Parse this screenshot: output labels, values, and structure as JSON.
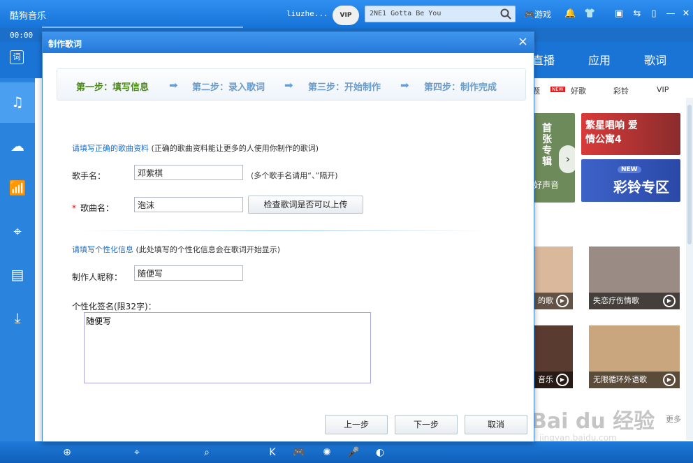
{
  "app": {
    "title": "酷狗音乐",
    "time": "00:00",
    "username": "liuzhe...",
    "vip": "VIP",
    "search_text": "2NE1 Gotta Be You",
    "game_label": "游戏",
    "lyric_icon": "词"
  },
  "nav": {
    "tabs": [
      "直播",
      "应用",
      "歌词"
    ]
  },
  "subnav": {
    "items": [
      "题",
      "好歌",
      "彩铃",
      "VIP"
    ],
    "new_tag": "NEW"
  },
  "banners": {
    "album_text": "首张专辑",
    "album_sub": "好声音",
    "drama_text": "繁星唱响 爱情公寓4",
    "ringtone_new": "NEW",
    "ringtone_text": "彩铃专区"
  },
  "tiles": [
    {
      "caption": "的歌"
    },
    {
      "caption": "失恋疗伤情歌"
    },
    {
      "caption": "音乐"
    },
    {
      "caption": "无限循环外语歌"
    }
  ],
  "more_label": "更多",
  "watermark": {
    "main": "Bai du 经验",
    "sub": "jingyan.baidu.com"
  },
  "dialog": {
    "title": "制作歌词",
    "close": "×",
    "steps": [
      {
        "label": "第一步：填写信息",
        "active": true
      },
      {
        "label": "第二步：录入歌词",
        "active": false
      },
      {
        "label": "第三步：开始制作",
        "active": false
      },
      {
        "label": "第四步：制作完成",
        "active": false
      }
    ],
    "section1_title": "请填写正确的歌曲资料",
    "section1_note": "(正确的歌曲资料能让更多的人使用你制作的歌词)",
    "singer_label": "歌手名：",
    "singer_value": "邓紫棋",
    "singer_hint": "(多个歌手名请用“、”隔开)",
    "required_mark": "*",
    "song_label": "歌曲名：",
    "song_value": "泡沫",
    "check_button": "检查歌词是否可以上传",
    "section2_title": "请填写个性化信息",
    "section2_note": "(此处填写的个性化信息会在歌词开始显示)",
    "nickname_label": "制作人昵称：",
    "nickname_value": "随便写",
    "signature_label": "个性化签名(限32字)：",
    "signature_value": "随便写",
    "prev_button": "上一步",
    "next_button": "下一步",
    "cancel_button": "取消"
  }
}
